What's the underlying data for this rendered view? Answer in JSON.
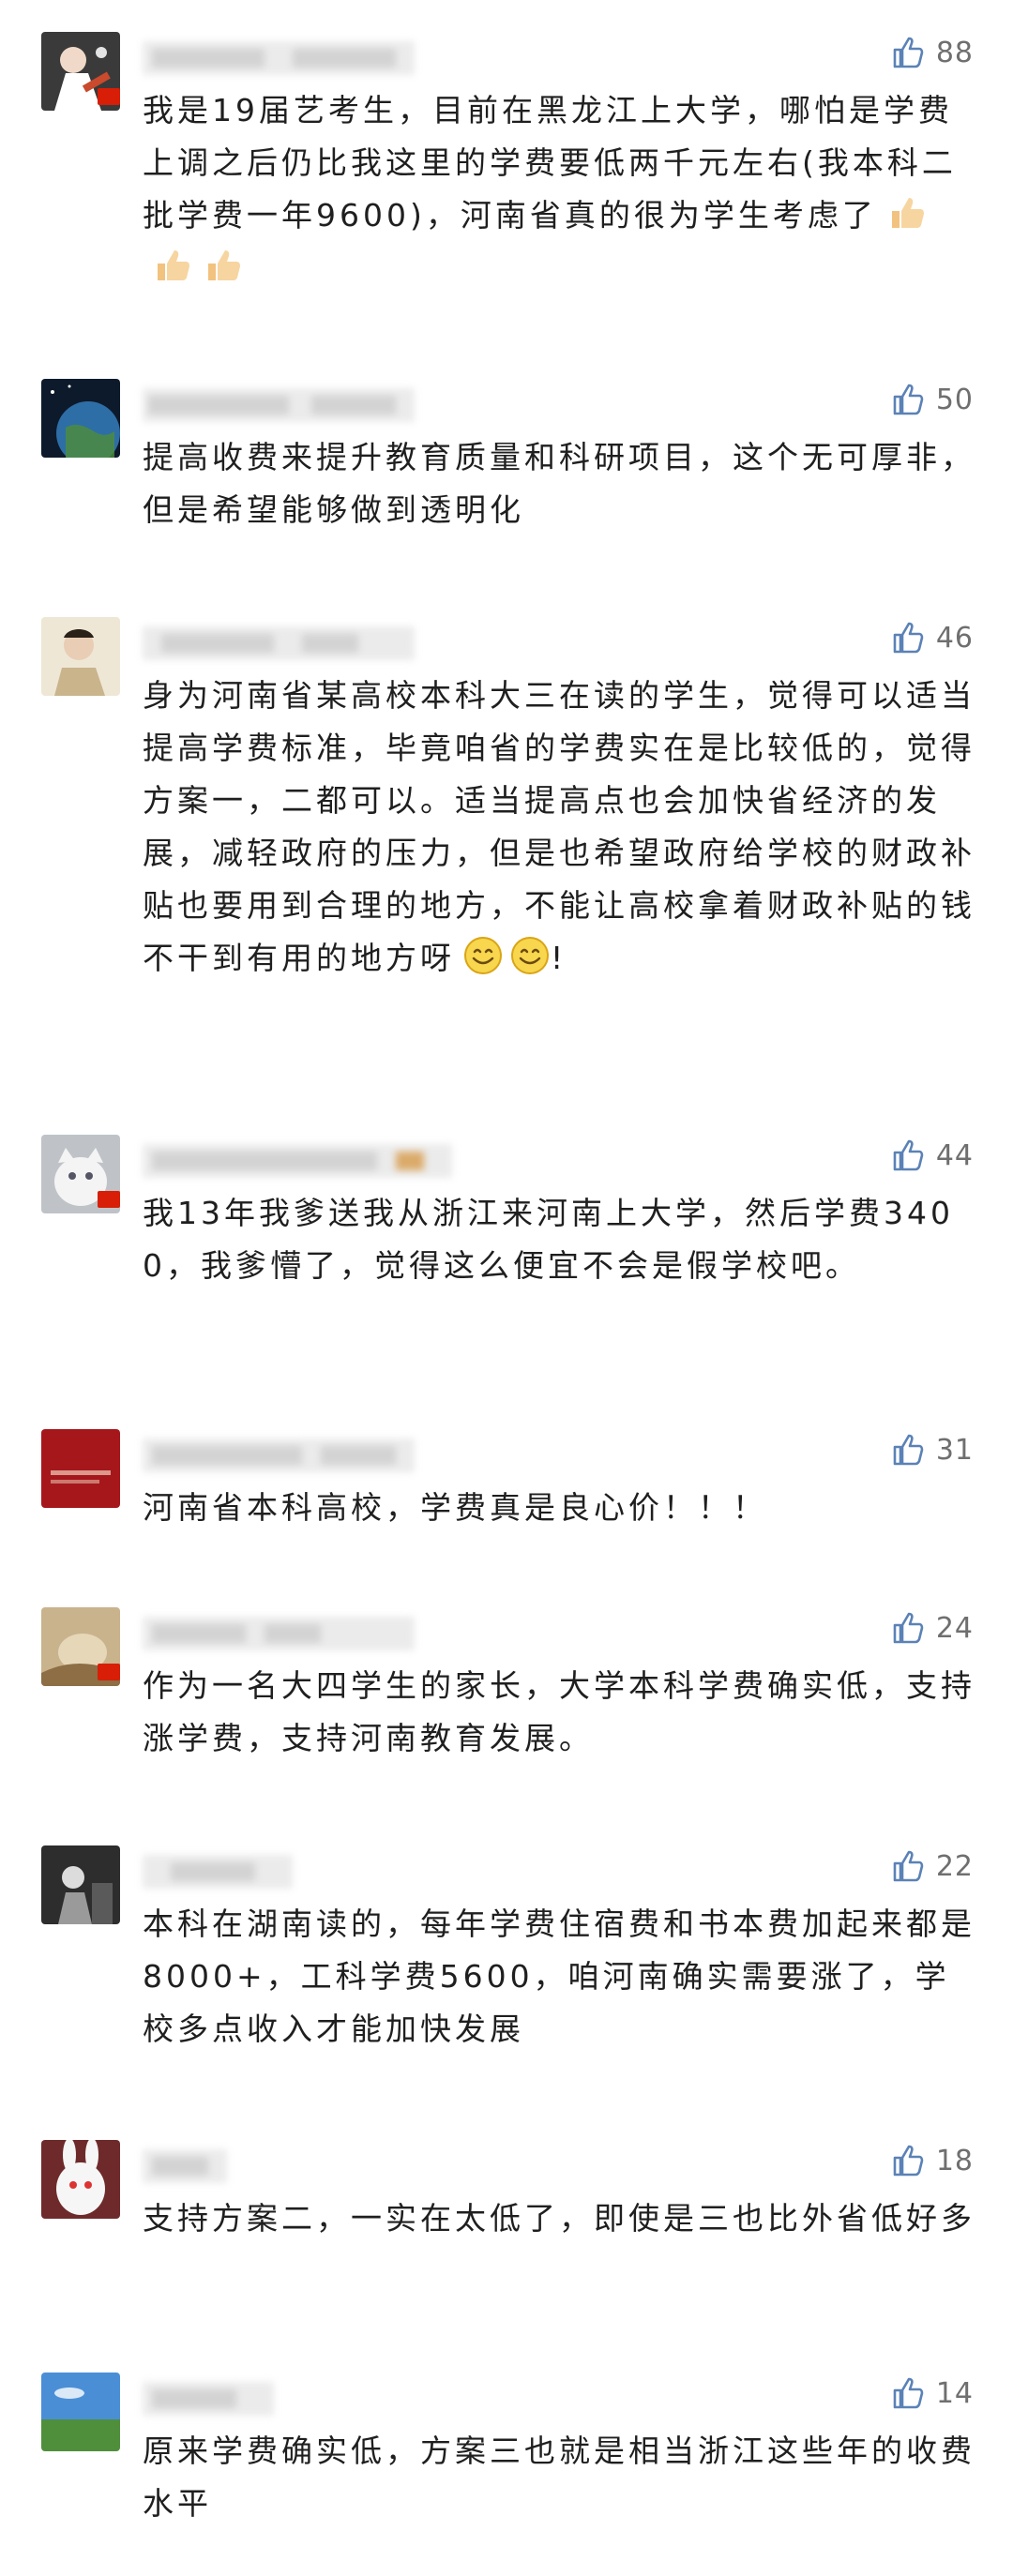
{
  "colors": {
    "like_icon": "#5b82b6",
    "count_text": "#6f6f6f",
    "body_text": "#1f1f1f",
    "flag_red": "#d81e06"
  },
  "comments": [
    {
      "likes": "88",
      "text": "我是19届艺考生，目前在黑龙江上大学，哪怕是学费上调之后仍比我这里的学费要低两千元左右(我本科二批学费一年9600)，河南省真的很为学生考虑了",
      "emoji": [
        "thumbs-up",
        "thumbs-up",
        "thumbs-up"
      ]
    },
    {
      "likes": "50",
      "text": "提高收费来提升教育质量和科研项目，这个无可厚非，但是希望能够做到透明化"
    },
    {
      "likes": "46",
      "text": "身为河南省某高校本科大三在读的学生，觉得可以适当提高学费标准，毕竟咱省的学费实在是比较低的，觉得方案一，二都可以。适当提高点也会加快省经济的发展，减轻政府的压力，但是也希望政府给学校的财政补贴也要用到合理的地方，不能让高校拿着财政补贴的钱不干到有用的地方呀",
      "text_tail": "!"
    },
    {
      "likes": "44",
      "text": "我13年我爹送我从浙江来河南上大学，然后学费3400，我爹懵了，觉得这么便宜不会是假学校吧。"
    },
    {
      "likes": "31",
      "text": "河南省本科高校，学费真是良心价！！！"
    },
    {
      "likes": "24",
      "text": "作为一名大四学生的家长，大学本科学费确实低，支持涨学费，支持河南教育发展。"
    },
    {
      "likes": "22",
      "text": "本科在湖南读的，每年学费住宿费和书本费加起来都是8000+，工科学费5600，咱河南确实需要涨了，学校多点收入才能加快发展"
    },
    {
      "likes": "18",
      "text": "支持方案二，一实在太低了，即使是三也比外省低好多"
    },
    {
      "likes": "14",
      "text": "原来学费确实低，方案三也就是相当浙江这些年的收费水平"
    }
  ]
}
